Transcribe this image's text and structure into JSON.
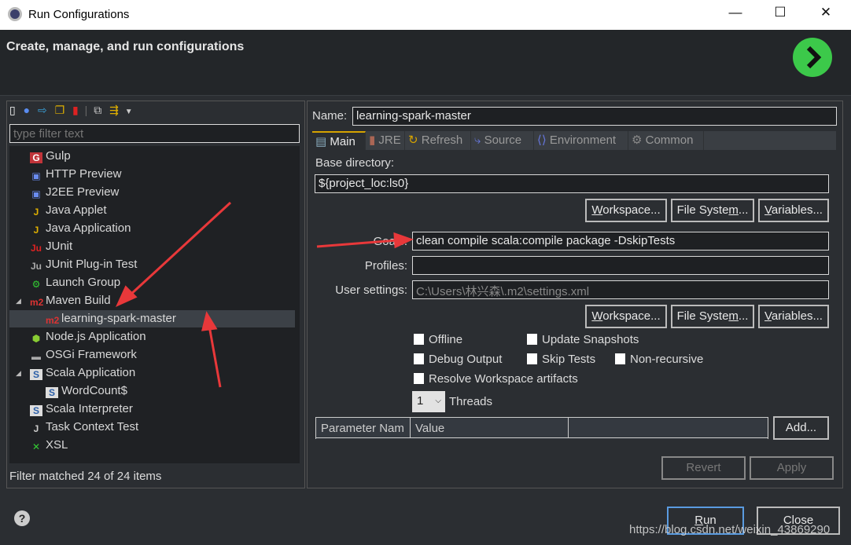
{
  "window": {
    "title": "Run Configurations",
    "controls": [
      "minimize",
      "maximize",
      "close"
    ]
  },
  "header": {
    "title": "Create, manage, and run configurations"
  },
  "left": {
    "toolbar": [
      "new-launch-config-icon",
      "new-prototype-icon",
      "export-icon",
      "duplicate-icon",
      "delete-icon",
      "collapse-all-icon",
      "filter-icon",
      "dropdown-icon"
    ],
    "filter_placeholder": "type filter text",
    "items": [
      {
        "label": "Gulp",
        "icon": "gulp-icon",
        "level": 1
      },
      {
        "label": "HTTP Preview",
        "icon": "preview-icon",
        "level": 1
      },
      {
        "label": "J2EE Preview",
        "icon": "preview-icon",
        "level": 1
      },
      {
        "label": "Java Applet",
        "icon": "java-applet-icon",
        "level": 1
      },
      {
        "label": "Java Application",
        "icon": "java-app-icon",
        "level": 1
      },
      {
        "label": "JUnit",
        "icon": "junit-icon",
        "level": 1
      },
      {
        "label": "JUnit Plug-in Test",
        "icon": "junit-plugin-icon",
        "level": 1
      },
      {
        "label": "Launch Group",
        "icon": "launch-group-icon",
        "level": 1
      },
      {
        "label": "Maven Build",
        "icon": "maven-icon",
        "level": 1,
        "expanded": true
      },
      {
        "label": "learning-spark-master",
        "icon": "maven-icon",
        "level": 2,
        "selected": true
      },
      {
        "label": "Node.js Application",
        "icon": "nodejs-icon",
        "level": 1
      },
      {
        "label": "OSGi Framework",
        "icon": "osgi-icon",
        "level": 1
      },
      {
        "label": "Scala Application",
        "icon": "scala-icon",
        "level": 1,
        "expanded": true
      },
      {
        "label": "WordCount$",
        "icon": "scala-icon",
        "level": 2
      },
      {
        "label": "Scala Interpreter",
        "icon": "scala-icon",
        "level": 1
      },
      {
        "label": "Task Context Test",
        "icon": "task-test-icon",
        "level": 1
      },
      {
        "label": "XSL",
        "icon": "xsl-icon",
        "level": 1
      }
    ],
    "status": "Filter matched 24 of 24 items"
  },
  "right": {
    "name_label": "Name:",
    "name_value": "learning-spark-master",
    "tabs": [
      "Main",
      "JRE",
      "Refresh",
      "Source",
      "Environment",
      "Common"
    ],
    "base_dir_label": "Base directory:",
    "base_dir_value": "${project_loc:ls0}",
    "workspace": "Workspace...",
    "filesystem": "File System...",
    "variables": "Variables...",
    "goals_label": "Goals:",
    "goals_value": "clean compile scala:compile package -DskipTests",
    "profiles_label": "Profiles:",
    "profiles_value": "",
    "user_settings_label": "User settings:",
    "user_settings_value": "C:\\Users\\林兴森\\.m2\\settings.xml",
    "checkboxes": {
      "offline": "Offline",
      "update": "Update Snapshots",
      "debug": "Debug Output",
      "skip": "Skip Tests",
      "nonrec": "Non-recursive",
      "resolve": "Resolve Workspace artifacts"
    },
    "threads_value": "1",
    "threads_label": "Threads",
    "table_headers": [
      "Parameter Nam",
      "Value"
    ],
    "add": "Add...",
    "revert": "Revert",
    "apply": "Apply"
  },
  "footer": {
    "run": "Run",
    "close": "Close",
    "watermark": "https://blog.csdn.net/weixin_43869290"
  }
}
